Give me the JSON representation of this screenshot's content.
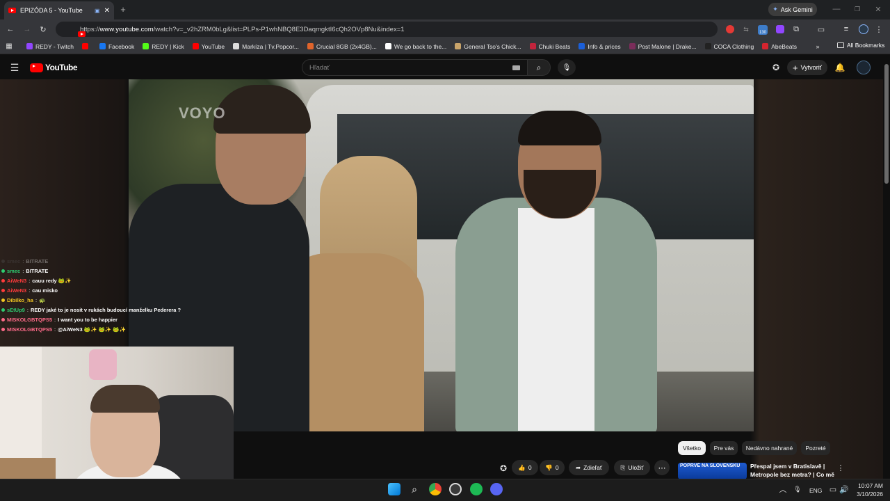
{
  "browser": {
    "tab_title": "EPIZÓDA 5 - YouTube",
    "new_tab": "+",
    "ask_gemini": "Ask Gemini",
    "url_prefix": "https://",
    "url_host": "www.youtube.com",
    "url_path": "/watch?v=_v2hZRM0bLg&list=PLPs-P1whNBQ8E3DaqmgktI6cQh2OVp8Nu&index=1",
    "extension_badge": "130",
    "bookmarks": [
      {
        "label": "REDY - Twitch",
        "color": "#9146ff"
      },
      {
        "label": "",
        "color": "#ff0000"
      },
      {
        "label": "Facebook",
        "color": "#1877f2"
      },
      {
        "label": "REDY | Kick",
        "color": "#53fc18"
      },
      {
        "label": "YouTube",
        "color": "#ff0000"
      },
      {
        "label": "Markíza | Tv.Popcor...",
        "color": "#dddddd"
      },
      {
        "label": "Crucial 8GB (2x4GB)...",
        "color": "#e0642b"
      },
      {
        "label": "We go back to the...",
        "color": "#ffffff"
      },
      {
        "label": "General Tso's Chick...",
        "color": "#c9a46a"
      },
      {
        "label": "Chuki Beats",
        "color": "#c2243c"
      },
      {
        "label": "Info & prices",
        "color": "#1b5fd9"
      },
      {
        "label": "Post Malone | Drake...",
        "color": "#7a2d5a"
      },
      {
        "label": "COCA Clothing",
        "color": "#222222"
      },
      {
        "label": "AbeBeats",
        "color": "#d4242f"
      }
    ],
    "all_bookmarks": "All Bookmarks"
  },
  "youtube": {
    "logo_text": "YouTube",
    "search_placeholder": "Hľadať",
    "create_label": "Vytvoriť",
    "video_watermark": "VOYO",
    "chips": [
      "Všetko",
      "Pre vás",
      "Nedávno nahrané",
      "Pozreté"
    ],
    "actions": {
      "like_count": "0",
      "dislike_count": "0",
      "share_label": "Zdieľať",
      "save_label": "Uložiť",
      "more": "⋯"
    },
    "recommended": {
      "thumb_text": "POPRVÉ NA SLOVENSKU",
      "title_line1": "Přespal jsem v Bratislavě |",
      "title_line2": "Metropole bez metra? | Co mě ..."
    }
  },
  "chat": [
    {
      "user": "smec",
      "message": "BITRATE",
      "user_color": "#555555",
      "faded": true
    },
    {
      "user": "smec",
      "message": "BITRATE",
      "user_color": "#2ecc71"
    },
    {
      "user": "AiWeN3",
      "message": "cauu redy 🐸✨",
      "user_color": "#ff3b3b"
    },
    {
      "user": "AiWeN3",
      "message": "cau misko",
      "user_color": "#ff3b3b"
    },
    {
      "user": "Dibilko_ha",
      "message": "🐢",
      "user_color": "#f3c623"
    },
    {
      "user": "sEtUp9",
      "message": "REDY jaké to je nosit v rukách budoucí manželku Pederera ?",
      "user_color": "#2ecc71"
    },
    {
      "user": "MISKOLGBTQPS5",
      "message": "I want you to be happier",
      "user_color": "#ff6b8a"
    },
    {
      "user": "MISKOLGBTQPS5",
      "message": "@AiWeN3 🐸✨ 🐸✨ 🐸✨",
      "user_color": "#ff6b8a"
    }
  ],
  "taskbar": {
    "lang": "ENG",
    "time": "10:07 AM",
    "date": "3/10/2026"
  }
}
